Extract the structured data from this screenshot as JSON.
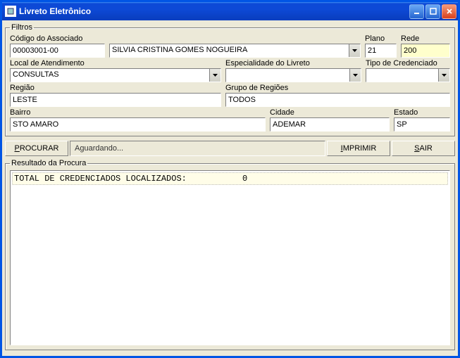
{
  "window": {
    "title": "Livreto Eletrônico"
  },
  "groups": {
    "filtros_legend": "Filtros",
    "resultado_legend": "Resultado da Procura"
  },
  "fields": {
    "codigo_label": "Código do Associado",
    "codigo_value": "00003001-00",
    "nome_value": "SILVIA CRISTINA GOMES NOGUEIRA",
    "plano_label": "Plano",
    "plano_value": "21",
    "rede_label": "Rede",
    "rede_value": "200",
    "local_label": "Local de Atendimento",
    "local_value": "CONSULTAS",
    "especialidade_label": "Especialidade do Livreto",
    "especialidade_value": "",
    "tipo_label": "Tipo de Credenciado",
    "tipo_value": "",
    "regiao_label": "Região",
    "regiao_value": "LESTE",
    "grupo_label": "Grupo de Regiões",
    "grupo_value": "TODOS",
    "bairro_label": "Bairro",
    "bairro_value": "STO AMARO",
    "cidade_label": "Cidade",
    "cidade_value": "ADEMAR",
    "estado_label": "Estado",
    "estado_value": "SP"
  },
  "buttons": {
    "procurar_pre": "",
    "procurar_key": "P",
    "procurar_post": "ROCURAR",
    "imprimir_pre": "",
    "imprimir_key": "I",
    "imprimir_post": "MPRIMIR",
    "sair_pre": "",
    "sair_key": "S",
    "sair_post": "AIR"
  },
  "status": {
    "text": "Aguardando..."
  },
  "results": {
    "line1": "TOTAL DE CREDENCIADOS LOCALIZADOS:           0"
  }
}
